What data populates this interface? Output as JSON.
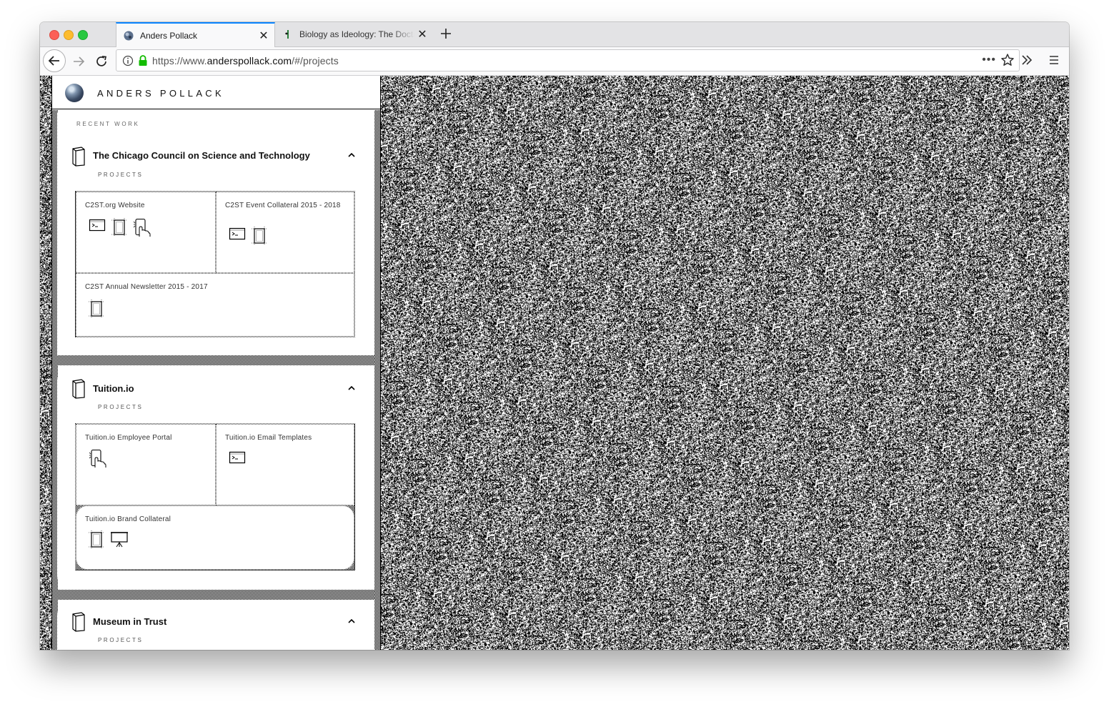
{
  "browser": {
    "tabs": [
      {
        "title": "Anders Pollack",
        "active": true,
        "icon": "globe-icon"
      },
      {
        "title": "Biology as Ideology: The Doctrine of DNA",
        "active": false,
        "icon": "book-icon"
      }
    ],
    "url": {
      "scheme": "https://www.",
      "host": "anderspollack.com",
      "path": "/#/projects"
    },
    "url_actions": "•••"
  },
  "site": {
    "name": "ANDERS POLLACK",
    "section_label": "RECENT WORK"
  },
  "clients": [
    {
      "name": "The Chicago Council on Science and Technology",
      "projects_label": "PROJECTS",
      "projects": [
        {
          "title": "C2ST.org Website",
          "icons": [
            "terminal-icon",
            "print-page-icon",
            "hand-pointer-icon"
          ]
        },
        {
          "title": "C2ST Event Collateral 2015 - 2018",
          "icons": [
            "terminal-icon",
            "print-page-icon"
          ]
        },
        {
          "title": "C2ST Annual Newsletter 2015 - 2017",
          "icons": [
            "print-page-icon"
          ]
        }
      ]
    },
    {
      "name": "Tuition.io",
      "projects_label": "PROJECTS",
      "projects": [
        {
          "title": "Tuition.io Employee Portal",
          "icons": [
            "hand-pointer-icon"
          ]
        },
        {
          "title": "Tuition.io Email Templates",
          "icons": [
            "terminal-icon"
          ]
        },
        {
          "title": "Tuition.io Brand Collateral",
          "icons": [
            "print-page-icon",
            "presentation-icon"
          ]
        }
      ]
    },
    {
      "name": "Museum in Trust",
      "projects_label": "PROJECTS",
      "projects": []
    }
  ],
  "colors": {
    "tab_accent": "#0a84ff",
    "lock_green": "#12bc00",
    "text": "#111111"
  }
}
